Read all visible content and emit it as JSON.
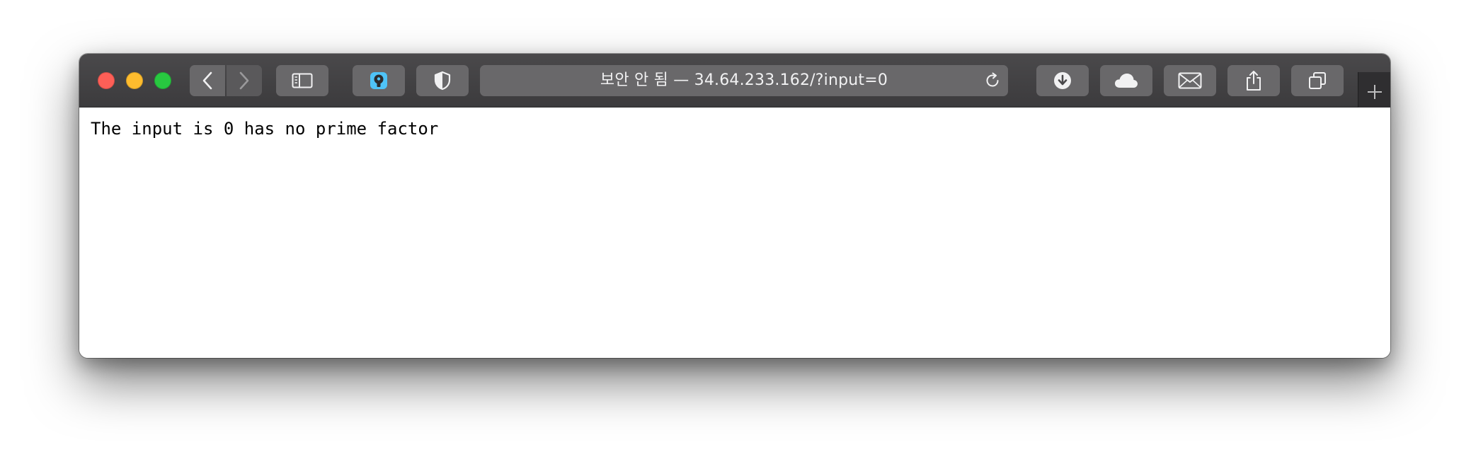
{
  "browser": {
    "address_bar": {
      "text": "보안 안 됨 — 34.64.233.162/?input=0"
    }
  },
  "page": {
    "body_text": "The input is 0 has no prime factor"
  },
  "colors": {
    "close": "#fe5f57",
    "minimize": "#febc2e",
    "maximize": "#28c840",
    "toolbar": "#3c3b3d",
    "password_accent": "#4fc3f7"
  },
  "icons": [
    "back-icon",
    "forward-icon",
    "sidebar-icon",
    "password-manager-icon",
    "privacy-shield-icon",
    "reload-icon",
    "downloads-icon",
    "icloud-icon",
    "mail-icon",
    "share-icon",
    "tab-overview-icon",
    "new-tab-icon"
  ]
}
